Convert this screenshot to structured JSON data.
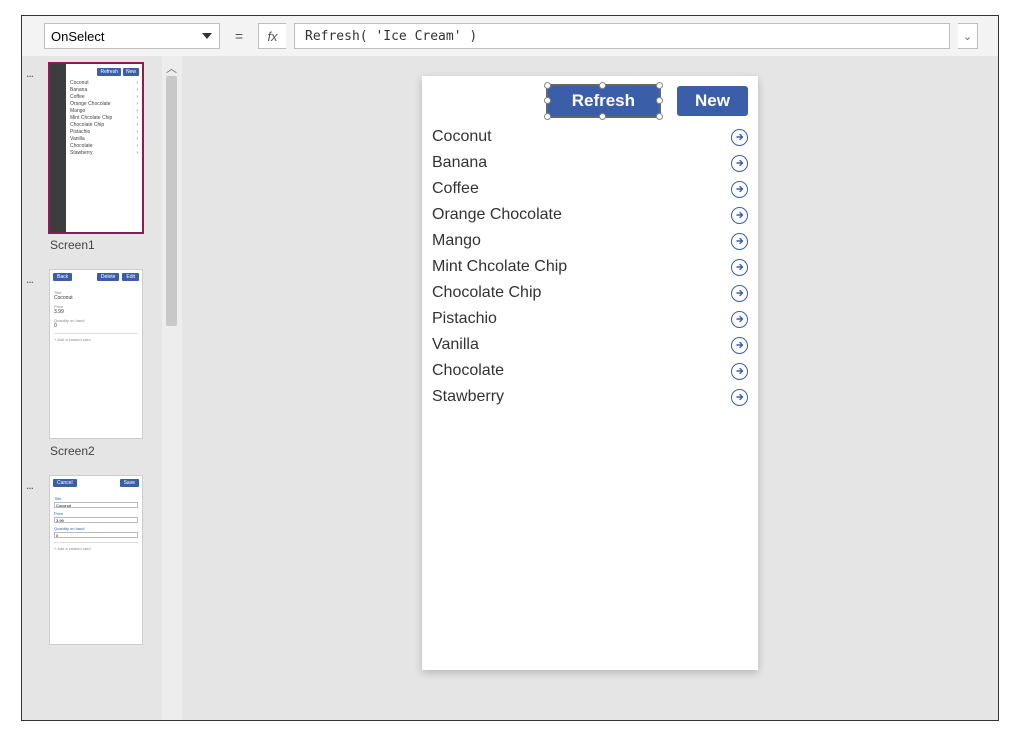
{
  "formula_bar": {
    "property": "OnSelect",
    "eq": "=",
    "fx": "fx",
    "formula": "Refresh( 'Ice Cream' )",
    "expand_glyph": "⌄"
  },
  "thumbnails": {
    "screen1": {
      "label": "Screen1",
      "btn_refresh": "Refresh",
      "btn_new": "New",
      "items": [
        "Coconut",
        "Banana",
        "Coffee",
        "Orange Chocolate",
        "Mango",
        "Mint Chcolate Chip",
        "Chocolate Chip",
        "Pistachio",
        "Vanilla",
        "Chocolate",
        "Stawberry"
      ]
    },
    "screen2": {
      "label": "Screen2",
      "btn_back": "Back",
      "btn_delete": "Delete",
      "btn_edit": "Edit",
      "lbl_title": "Title",
      "val_title": "Coconut",
      "lbl_price": "Price",
      "val_price": "3.99",
      "lbl_qty": "Quantity on hand",
      "val_qty": "0",
      "add_card": "+  Add a custom card"
    },
    "screen3": {
      "btn_cancel": "Cancel",
      "btn_save": "Save",
      "lbl_title": "Title",
      "val_title": "Coconut",
      "lbl_price": "Price",
      "val_price": "3.99",
      "lbl_qty": "Quantity on hand",
      "val_qty": "0",
      "add_card": "+  Add a custom card"
    }
  },
  "canvas": {
    "btn_refresh": "Refresh",
    "btn_new": "New",
    "items": [
      "Coconut",
      "Banana",
      "Coffee",
      "Orange Chocolate",
      "Mango",
      "Mint Chcolate Chip",
      "Chocolate Chip",
      "Pistachio",
      "Vanilla",
      "Chocolate",
      "Stawberry"
    ]
  }
}
